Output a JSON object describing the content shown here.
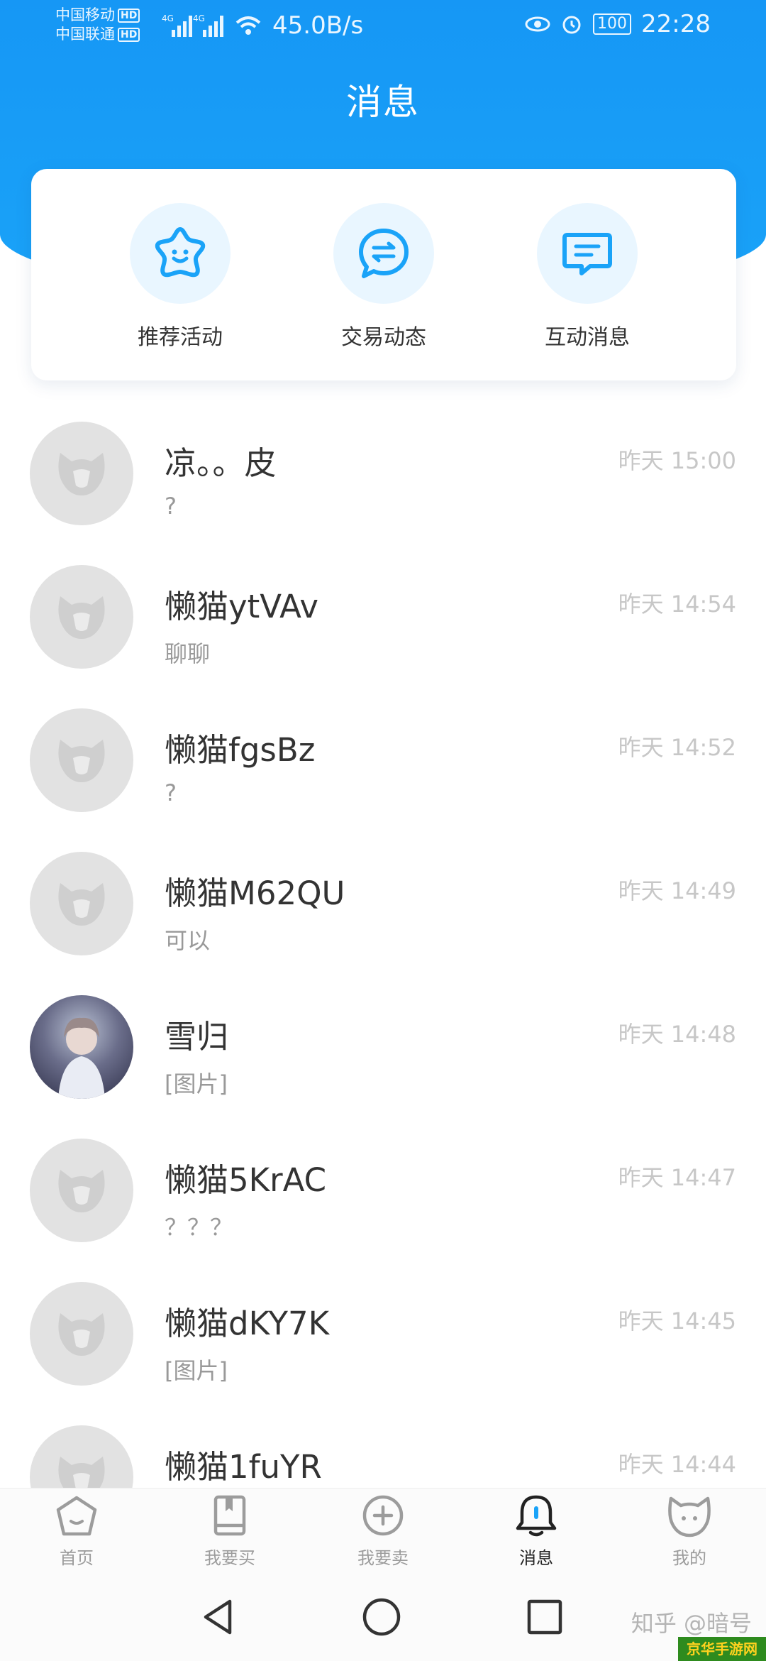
{
  "status_bar": {
    "carrier1": "中国移动",
    "carrier2": "中国联通",
    "hd": "HD",
    "net": "4G",
    "speed": "45.0B/s",
    "battery": "100",
    "time": "22:28"
  },
  "header": {
    "title": "消息"
  },
  "quick_actions": [
    {
      "label": "推荐活动",
      "icon": "star-smile-icon"
    },
    {
      "label": "交易动态",
      "icon": "exchange-bubble-icon"
    },
    {
      "label": "互动消息",
      "icon": "message-lines-icon"
    }
  ],
  "conversations": [
    {
      "name": "凉。。皮",
      "message": "?",
      "time": "昨天 15:00",
      "avatar": "default"
    },
    {
      "name": "懒猫ytVAv",
      "message": "聊聊",
      "time": "昨天 14:54",
      "avatar": "default"
    },
    {
      "name": "懒猫fgsBz",
      "message": "?",
      "time": "昨天 14:52",
      "avatar": "default"
    },
    {
      "name": "懒猫M62QU",
      "message": "可以",
      "time": "昨天 14:49",
      "avatar": "default"
    },
    {
      "name": "雪归",
      "message": "[图片]",
      "time": "昨天 14:48",
      "avatar": "photo"
    },
    {
      "name": "懒猫5KrAC",
      "message": "？？？",
      "time": "昨天 14:47",
      "avatar": "default"
    },
    {
      "name": "懒猫dKY7K",
      "message": "[图片]",
      "time": "昨天 14:45",
      "avatar": "default"
    },
    {
      "name": "懒猫1fuYR",
      "message": "",
      "time": "昨天 14:44",
      "avatar": "default"
    }
  ],
  "tabs": [
    {
      "label": "首页",
      "icon": "home-pentagon-icon"
    },
    {
      "label": "我要买",
      "icon": "book-icon"
    },
    {
      "label": "我要卖",
      "icon": "plus-circle-icon"
    },
    {
      "label": "消息",
      "icon": "bell-icon",
      "active": true
    },
    {
      "label": "我的",
      "icon": "cat-face-icon"
    }
  ],
  "watermark": "知乎 @暗号",
  "site_badge": "京华手游网",
  "colors": {
    "primary": "#1a9cf6",
    "icon_blue": "#1aa3f8",
    "quick_bg": "#e9f6ff"
  }
}
